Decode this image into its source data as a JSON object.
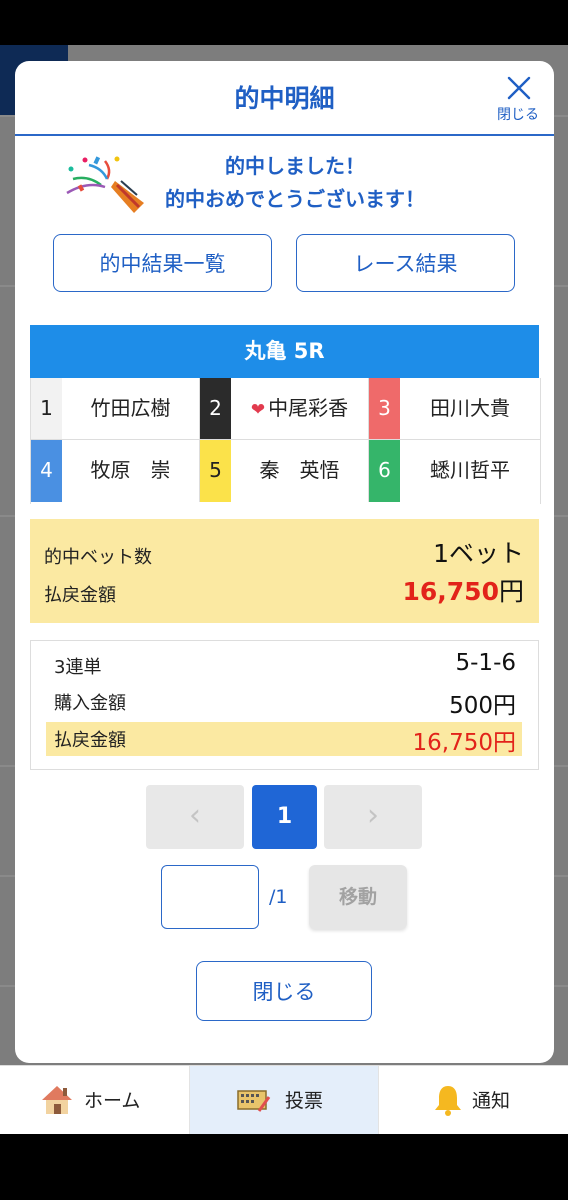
{
  "modal": {
    "title": "的中明細",
    "close_label": "閉じる",
    "congrats_line1": "的中しました！",
    "congrats_line2": "的中おめでとうございます！",
    "buttons": {
      "hit_list": "的中結果一覧",
      "race_result": "レース結果",
      "close": "閉じる"
    }
  },
  "race": {
    "title": "丸亀 5R",
    "racers": [
      {
        "no": "1",
        "name": "竹田広樹",
        "color": "#f2f2f2",
        "text_color": "#222222"
      },
      {
        "no": "2",
        "name": "中尾彩香",
        "color": "#2b2b2b",
        "text_color": "#ffffff",
        "favorite": true,
        "icon": "heart-icon"
      },
      {
        "no": "3",
        "name": "田川大貴",
        "color": "#ef6a6a",
        "text_color": "#ffffff"
      },
      {
        "no": "4",
        "name": "牧原　崇",
        "color": "#4a90e2",
        "text_color": "#ffffff"
      },
      {
        "no": "5",
        "name": "秦　英悟",
        "color": "#fbe24a",
        "text_color": "#222222"
      },
      {
        "no": "6",
        "name": "蟋川哲平",
        "color": "#35b56a",
        "text_color": "#ffffff"
      }
    ]
  },
  "summary": {
    "bets_label": "的中ベット数",
    "bets_value": "1ベット",
    "payout_label": "払戻金額",
    "payout_amount": "16,750",
    "payout_unit": "円"
  },
  "detail": {
    "bet_type_label": "3連単",
    "combination": "5-1-6",
    "purchase_label": "購入金額",
    "purchase_value": "500円",
    "payout_label": "払戻金額",
    "payout_value": "16,750円"
  },
  "pagination": {
    "prev_icon": "chevron-left-icon",
    "current_page": "1",
    "next_icon": "chevron-right-icon",
    "page_input_value": "",
    "total": "/1",
    "move_label": "移動"
  },
  "tabs": [
    {
      "label": "ホーム",
      "icon": "house-icon"
    },
    {
      "label": "投票",
      "icon": "ticket-icon",
      "active": true
    },
    {
      "label": "通知",
      "icon": "bell-icon"
    }
  ],
  "colors": {
    "accent": "#1f5fc4",
    "race_header": "#1e8de8",
    "highlight": "#fbe9a2",
    "payout_red": "#e2231a"
  }
}
